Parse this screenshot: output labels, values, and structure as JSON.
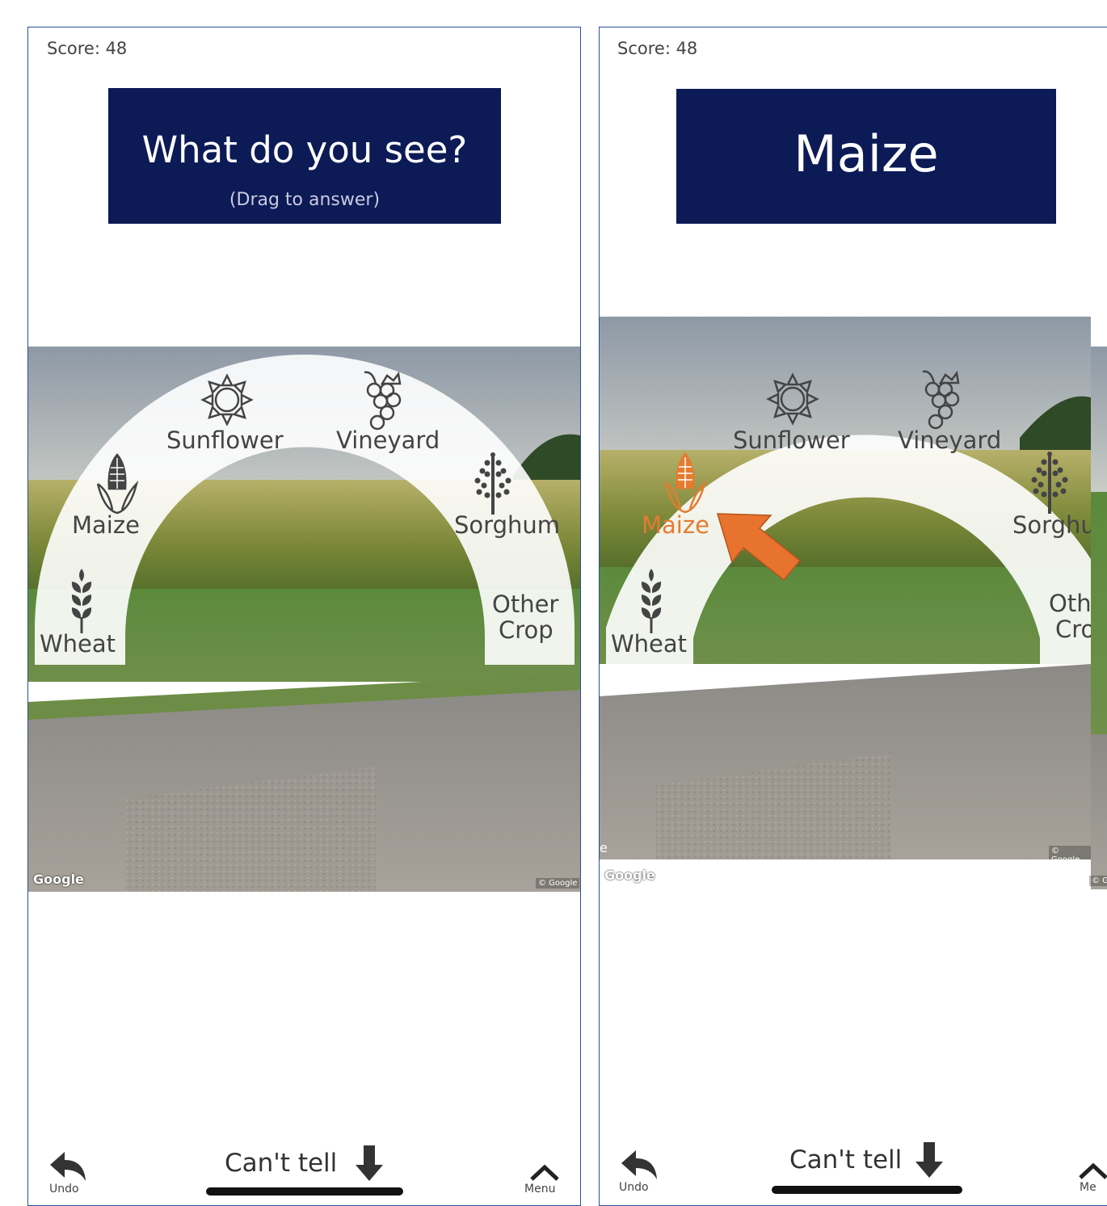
{
  "screens": [
    {
      "score": "Score: 48",
      "title": "What do you see?",
      "subtitle": "(Drag to answer)",
      "options": [
        {
          "label": "Sunflower",
          "icon": "sunflower-icon"
        },
        {
          "label": "Vineyard",
          "icon": "grapes-icon"
        },
        {
          "label": "Maize",
          "icon": "corn-icon"
        },
        {
          "label": "Sorghum",
          "icon": "sorghum-icon"
        },
        {
          "label": "Wheat",
          "icon": "wheat-icon"
        },
        {
          "label": "Other",
          "label2": "Crop",
          "icon": null
        }
      ],
      "google": "Google",
      "copyright": "© Google",
      "cant_tell": "Can't tell",
      "undo": "Undo",
      "menu": "Menu"
    },
    {
      "score": "Score: 48",
      "title": "Maize",
      "selected": "Maize",
      "options": [
        {
          "label": "Sunflower",
          "icon": "sunflower-icon"
        },
        {
          "label": "Vineyard",
          "icon": "grapes-icon"
        },
        {
          "label": "Maize",
          "icon": "corn-icon"
        },
        {
          "label": "Sorghum",
          "icon": "sorghum-icon"
        },
        {
          "label": "Wheat",
          "icon": "wheat-icon"
        },
        {
          "label": "Othe",
          "label2": "Crop",
          "icon": null
        }
      ],
      "google": "Google",
      "copyright": "© Google",
      "copyright_small": "© G",
      "edge_letter": "e",
      "cant_tell": "Can't tell",
      "undo": "Undo",
      "menu": "Me"
    }
  ],
  "colors": {
    "banner": "#0c1a56",
    "selected": "#e47b2e",
    "arrow": "#e8732e",
    "frame": "#2c4f9e"
  }
}
